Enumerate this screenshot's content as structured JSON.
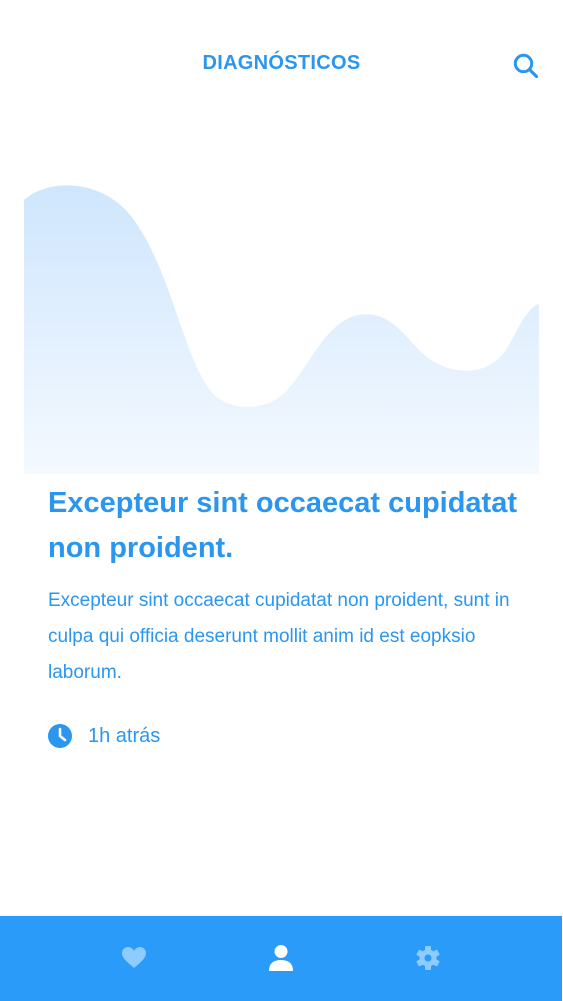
{
  "header": {
    "title": "DIAGNÓSTICOS",
    "search_icon": "search-icon"
  },
  "article": {
    "title": "Excepteur sint occaecat cupidatat non proident.",
    "body": "Excepteur sint occaecat cupidatat non proident, sunt in culpa qui officia deserunt mollit anim id est eopksio laborum.",
    "time_icon": "clock-icon",
    "time": "1h atrás"
  },
  "bottom_nav": {
    "items": [
      {
        "icon": "heart-icon",
        "active": false
      },
      {
        "icon": "user-icon",
        "active": true
      },
      {
        "icon": "gear-icon",
        "active": false
      }
    ]
  },
  "colors": {
    "accent": "#2a96f0",
    "nav_background": "#2a9bf8",
    "nav_icon_active": "#ffffff",
    "nav_icon_inactive": "#8ecbff",
    "wave_top": "#cfe6fd",
    "wave_bottom": "#f4f9ff"
  }
}
